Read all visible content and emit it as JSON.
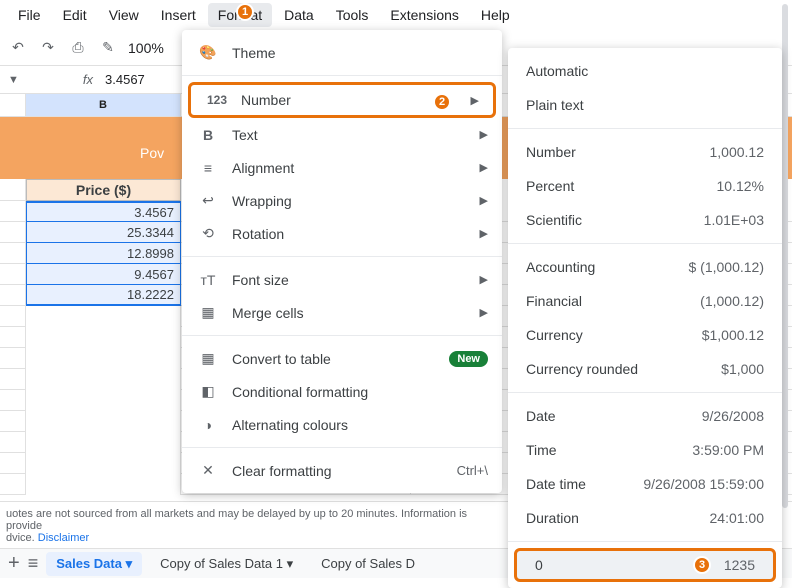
{
  "menubar": [
    "File",
    "Edit",
    "View",
    "Insert",
    "Format",
    "Data",
    "Tools",
    "Extensions",
    "Help"
  ],
  "active_menu": "Format",
  "toolbar": {
    "zoom": "100%"
  },
  "formula": {
    "namebox": "",
    "value": "3.4567"
  },
  "sheet": {
    "col_b_label": "B",
    "banner_fragment": "Pov",
    "price_header": "Price ($)",
    "values": [
      "3.4567",
      "25.3344",
      "12.8998",
      "9.4567",
      "18.2222"
    ]
  },
  "format_menu": {
    "theme": "Theme",
    "number": "Number",
    "text": "Text",
    "alignment": "Alignment",
    "wrapping": "Wrapping",
    "rotation": "Rotation",
    "font_size": "Font size",
    "merge_cells": "Merge cells",
    "convert_table": "Convert to table",
    "new_badge": "New",
    "conditional": "Conditional formatting",
    "alternating": "Alternating colours",
    "clear": "Clear formatting",
    "clear_shortcut": "Ctrl+\\"
  },
  "number_submenu": {
    "items": [
      {
        "label": "Automatic",
        "sample": ""
      },
      {
        "label": "Plain text",
        "sample": ""
      },
      {
        "sep": true
      },
      {
        "label": "Number",
        "sample": "1,000.12"
      },
      {
        "label": "Percent",
        "sample": "10.12%"
      },
      {
        "label": "Scientific",
        "sample": "1.01E+03"
      },
      {
        "sep": true
      },
      {
        "label": "Accounting",
        "sample": "$ (1,000.12)"
      },
      {
        "label": "Financial",
        "sample": "(1,000.12)"
      },
      {
        "label": "Currency",
        "sample": "$1,000.12"
      },
      {
        "label": "Currency rounded",
        "sample": "$1,000"
      },
      {
        "sep": true
      },
      {
        "label": "Date",
        "sample": "9/26/2008"
      },
      {
        "label": "Time",
        "sample": "3:59:00 PM"
      },
      {
        "label": "Date time",
        "sample": "9/26/2008 15:59:00"
      },
      {
        "label": "Duration",
        "sample": "24:01:00"
      },
      {
        "sep": true
      },
      {
        "label": "0",
        "sample": "1235",
        "highlight": true
      }
    ]
  },
  "footer": {
    "disclaimer_prefix": "uotes are not sourced from all markets and may be delayed by up to 20 minutes. Information is provide",
    "disclaimer_line2_prefix": "dvice. ",
    "disclaimer_link": "Disclaimer",
    "tabs": [
      "Sales Data",
      "Copy of Sales Data 1",
      "Copy of Sales D"
    ],
    "active_tab": 0
  },
  "annotations": {
    "b1": "1",
    "b2": "2",
    "b3": "3"
  }
}
